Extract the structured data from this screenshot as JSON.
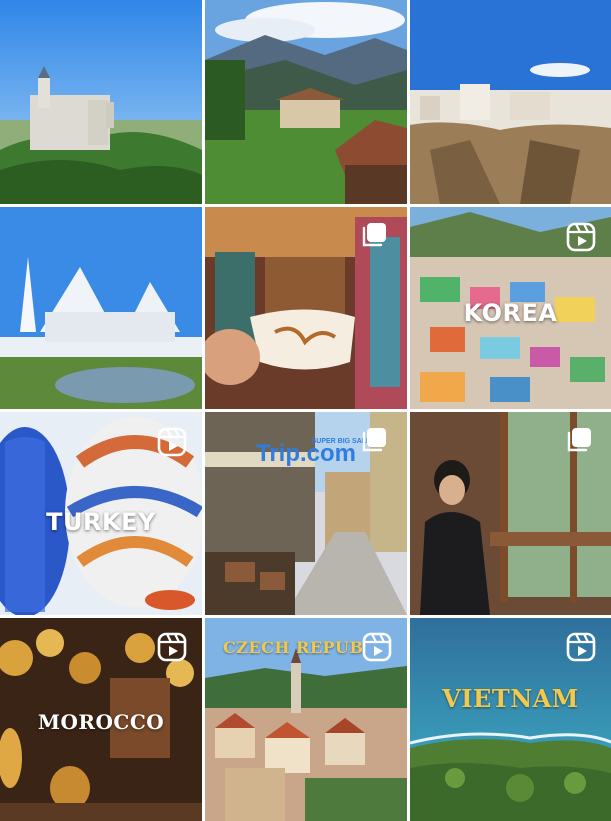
{
  "grid": {
    "tiles": [
      {
        "name": "castle",
        "type": "photo",
        "overlay": ""
      },
      {
        "name": "mountain-farm",
        "type": "photo",
        "overlay": ""
      },
      {
        "name": "cliff-town",
        "type": "photo",
        "overlay": ""
      },
      {
        "name": "white-temple",
        "type": "photo",
        "overlay": ""
      },
      {
        "name": "coffee-cafe",
        "type": "multi",
        "overlay": ""
      },
      {
        "name": "korea",
        "type": "reel",
        "overlay": "KOREA"
      },
      {
        "name": "turkey",
        "type": "reel",
        "overlay": "TURKEY"
      },
      {
        "name": "trip-street",
        "type": "multi",
        "overlay": "",
        "logo": "Trip.com",
        "sale": "SUPER BIG SALE !"
      },
      {
        "name": "window-seat",
        "type": "multi",
        "overlay": ""
      },
      {
        "name": "morocco",
        "type": "reel",
        "overlay": "MOROCCO"
      },
      {
        "name": "czech",
        "type": "reel",
        "overlay": "CZECH REPUB"
      },
      {
        "name": "vietnam",
        "type": "reel",
        "overlay": "VIETNAM"
      }
    ]
  },
  "icons": {
    "reel": "reels-icon",
    "multi": "carousel-icon"
  },
  "colors": {
    "badge": "#ffffff",
    "gold": "#f2c94c",
    "trip_blue": "#2f7de1"
  }
}
